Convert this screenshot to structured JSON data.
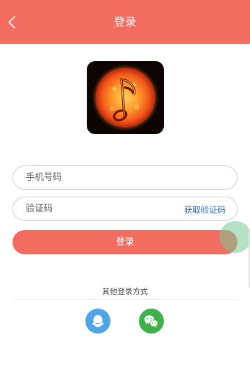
{
  "header": {
    "title": "登录"
  },
  "form": {
    "phone_placeholder": "手机号码",
    "code_placeholder": "验证码",
    "get_code_label": "获取验证码",
    "login_label": "登录"
  },
  "other": {
    "label": "其他登录方式"
  },
  "colors": {
    "accent": "#f26d5f",
    "link": "#2d6ab5",
    "qq": "#4ea6e6",
    "wechat": "#3fb04a"
  },
  "icons": {
    "back": "chevron-left-icon",
    "logo": "music-note-sun-logo",
    "qq": "qq-icon",
    "wechat": "wechat-icon"
  }
}
